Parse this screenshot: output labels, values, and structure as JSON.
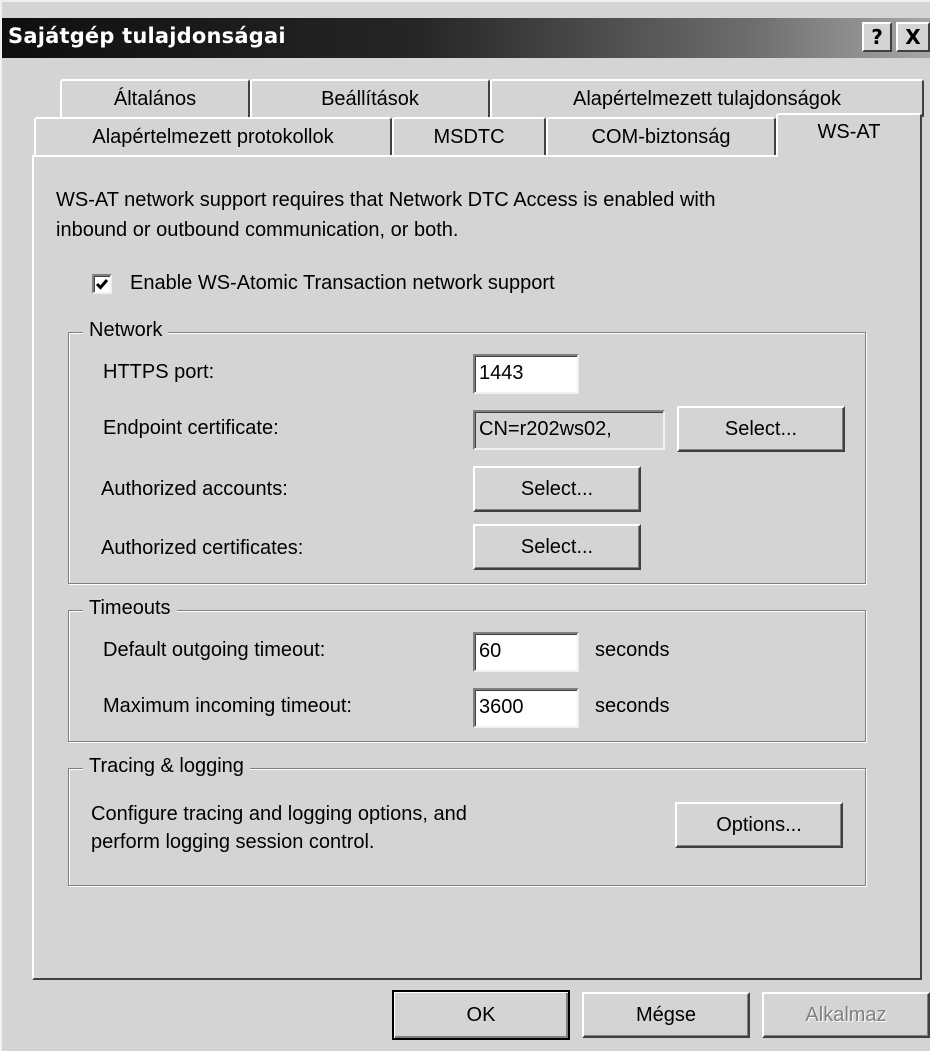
{
  "window": {
    "title": "Sajátgép tulajdonságai",
    "help_label": "?",
    "close_label": "X"
  },
  "tabs": {
    "row_back": [
      {
        "label": "Általános"
      },
      {
        "label": "Beállítások"
      },
      {
        "label": "Alapértelmezett tulajdonságok"
      }
    ],
    "row_front": [
      {
        "label": "Alapértelmezett protokollok"
      },
      {
        "label": "MSDTC"
      },
      {
        "label": "COM-biztonság"
      },
      {
        "label": "WS-AT"
      }
    ],
    "active": "WS-AT"
  },
  "wsat": {
    "intro_line1": "WS-AT network support requires that Network DTC Access is enabled with",
    "intro_line2": "inbound or outbound communication, or both.",
    "enable_label": "Enable WS-Atomic Transaction network support",
    "enable_checked": true
  },
  "network": {
    "legend": "Network",
    "https_port_label": "HTTPS port:",
    "https_port_value": "1443",
    "endpoint_cert_label": "Endpoint certificate:",
    "endpoint_cert_value": "CN=r202ws02,",
    "endpoint_select_label": "Select...",
    "authorized_accounts_label": "Authorized accounts:",
    "authorized_accounts_select": "Select...",
    "authorized_certs_label": "Authorized certificates:",
    "authorized_certs_select": "Select..."
  },
  "timeouts": {
    "legend": "Timeouts",
    "outgoing_label": "Default outgoing timeout:",
    "outgoing_value": "60",
    "outgoing_unit": "seconds",
    "incoming_label": "Maximum incoming timeout:",
    "incoming_value": "3600",
    "incoming_unit": "seconds"
  },
  "tracing": {
    "legend": "Tracing & logging",
    "desc_line1": "Configure tracing and logging options, and",
    "desc_line2": "perform logging session control.",
    "options_label": "Options..."
  },
  "footer": {
    "ok_label": "OK",
    "cancel_label": "Mégse",
    "apply_label": "Alkalmaz"
  }
}
